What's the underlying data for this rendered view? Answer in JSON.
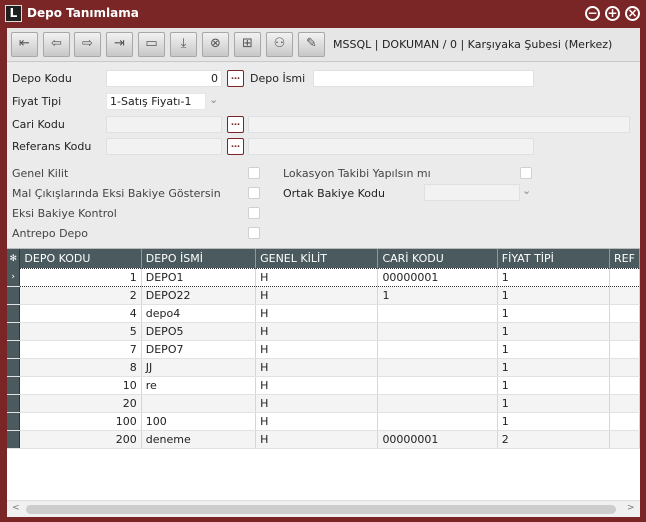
{
  "window": {
    "title": "Depo Tanımlama",
    "logo": "L",
    "minimize": "−",
    "maximize": "+",
    "close": "×"
  },
  "toolbar": {
    "buttons": [
      {
        "name": "first-record-button",
        "icon": "⇤"
      },
      {
        "name": "previous-record-button",
        "icon": "⇦"
      },
      {
        "name": "next-record-button",
        "icon": "⇨"
      },
      {
        "name": "last-record-button",
        "icon": "⇥"
      },
      {
        "name": "new-record-button",
        "icon": "▭"
      },
      {
        "name": "save-button",
        "icon": "⤓"
      },
      {
        "name": "delete-button",
        "icon": "⊗"
      },
      {
        "name": "copy-button",
        "icon": "⊞"
      },
      {
        "name": "user-button",
        "icon": "⚇"
      },
      {
        "name": "edit-button",
        "icon": "✎"
      }
    ],
    "info": "MSSQL | DOKUMAN / 0 | Karşıyaka Şubesi (Merkez)"
  },
  "form": {
    "depo_kodu_label": "Depo Kodu",
    "depo_kodu_value": "0",
    "depo_ismi_label": "Depo İsmi",
    "depo_ismi_value": "",
    "fiyat_tipi_label": "Fiyat Tipi",
    "fiyat_tipi_value": "1-Satış Fiyatı-1",
    "cari_kodu_label": "Cari Kodu",
    "cari_kodu_value": "",
    "referans_kodu_label": "Referans Kodu",
    "referans_kodu_value": "",
    "genel_kilit_label": "Genel Kilit",
    "mal_cikis_label": "Mal Çıkışlarında Eksi Bakiye Göstersin",
    "eksi_bakiye_label": "Eksi Bakiye Kontrol",
    "antrepo_label": "Antrepo Depo",
    "lokasyon_label": "Lokasyon Takibi Yapılsın mı",
    "ortak_bakiye_label": "Ortak Bakiye Kodu",
    "ortak_bakiye_value": "",
    "dropdown_arrow": "⌄"
  },
  "grid": {
    "columns": [
      "DEPO KODU",
      "DEPO İSMİ",
      "GENEL KİLİT",
      "CARİ KODU",
      "FİYAT TİPİ",
      "REF"
    ],
    "corner": "✻",
    "current_marker": "›",
    "rows": [
      {
        "kod": "1",
        "isim": "DEPO1",
        "kilit": "H",
        "cari": "00000001",
        "fiyat": "1"
      },
      {
        "kod": "2",
        "isim": "DEPO22",
        "kilit": "H",
        "cari": "1",
        "fiyat": "1"
      },
      {
        "kod": "4",
        "isim": "depo4",
        "kilit": "H",
        "cari": "",
        "fiyat": "1"
      },
      {
        "kod": "5",
        "isim": "DEPO5",
        "kilit": "H",
        "cari": "",
        "fiyat": "1"
      },
      {
        "kod": "7",
        "isim": "DEPO7",
        "kilit": "H",
        "cari": "",
        "fiyat": "1"
      },
      {
        "kod": "8",
        "isim": "JJ",
        "kilit": "H",
        "cari": "",
        "fiyat": "1"
      },
      {
        "kod": "10",
        "isim": "re",
        "kilit": "H",
        "cari": "",
        "fiyat": "1"
      },
      {
        "kod": "20",
        "isim": "",
        "kilit": "H",
        "cari": "",
        "fiyat": "1"
      },
      {
        "kod": "100",
        "isim": "100",
        "kilit": "H",
        "cari": "",
        "fiyat": "1"
      },
      {
        "kod": "200",
        "isim": "deneme",
        "kilit": "H",
        "cari": "00000001",
        "fiyat": "2"
      }
    ]
  },
  "scrollbar": {
    "left_arrow": "<",
    "right_arrow": ">"
  },
  "colors": {
    "accent": "#7a2626",
    "grid_header": "#4a5a5e"
  }
}
